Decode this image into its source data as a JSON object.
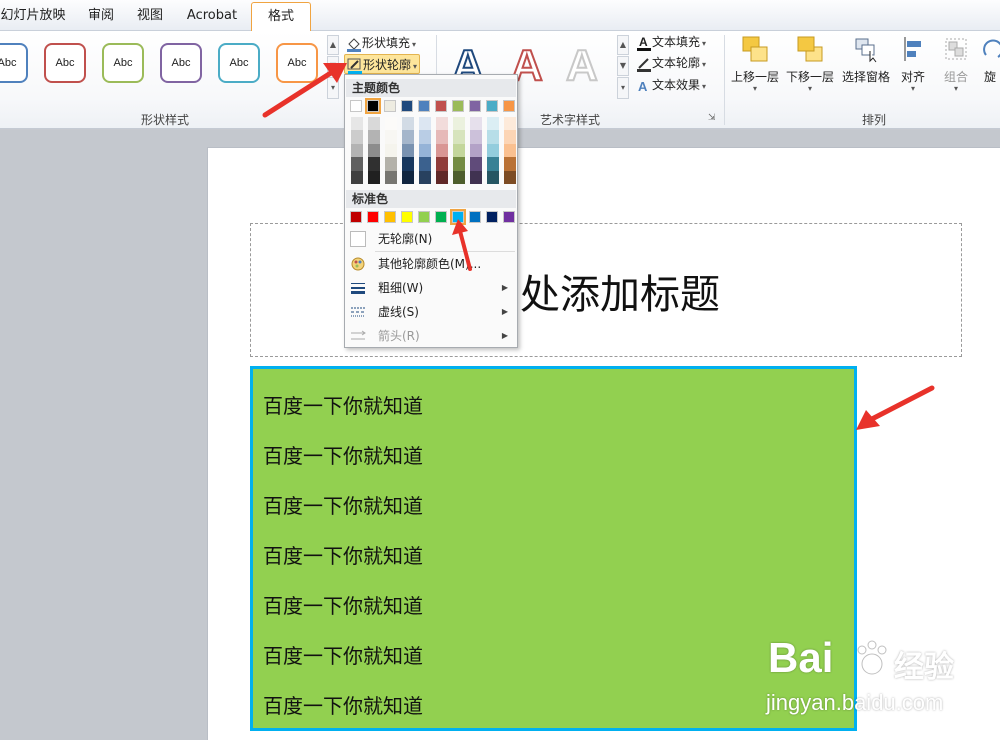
{
  "tabs": [
    {
      "label": "幻灯片放映",
      "active": false
    },
    {
      "label": "审阅",
      "active": false
    },
    {
      "label": "视图",
      "active": false
    },
    {
      "label": "Acrobat",
      "active": false
    },
    {
      "label": "格式",
      "active": true
    }
  ],
  "shape_styles": {
    "group_label": "形状样式",
    "swatches": [
      {
        "label": "Abc",
        "border": "#4f81bd"
      },
      {
        "label": "Abc",
        "border": "#c0504d"
      },
      {
        "label": "Abc",
        "border": "#9bbb59"
      },
      {
        "label": "Abc",
        "border": "#8064a2"
      },
      {
        "label": "Abc",
        "border": "#4bacc6"
      },
      {
        "label": "Abc",
        "border": "#f79646"
      }
    ],
    "shape_fill_label": "形状填充",
    "shape_outline_label": "形状轮廓"
  },
  "wordart": {
    "group_label": "艺术字样式",
    "text_fill_label": "文本填充",
    "text_outline_label": "文本轮廓",
    "text_effect_label": "文本效果"
  },
  "arrange": {
    "group_label": "排列",
    "bring_forward": "上移一层",
    "send_backward": "下移一层",
    "selection_pane": "选择窗格",
    "align": "对齐",
    "group": "组合",
    "rotate": "旋"
  },
  "outline_menu": {
    "theme_colors_label": "主题颜色",
    "theme_top_row": [
      "#ffffff",
      "#000000",
      "#eeece1",
      "#1f497d",
      "#4f81bd",
      "#c0504d",
      "#9bbb59",
      "#8064a2",
      "#4bacc6",
      "#f79646"
    ],
    "standard_colors_label": "标准色",
    "standard_colors": [
      "#c00000",
      "#ff0000",
      "#ffc000",
      "#ffff00",
      "#92d050",
      "#00b050",
      "#00b0f0",
      "#0070c0",
      "#002060",
      "#7030a0"
    ],
    "selected_standard_color": "#00b0f0",
    "no_outline": "无轮廓(N)",
    "more_colors": "其他轮廓颜色(M)...",
    "weight": "粗细(W)",
    "dashes": "虚线(S)",
    "arrows": "箭头(R)"
  },
  "slide": {
    "title_visible": "比处添加标题",
    "textbox_fill": "#92d050",
    "textbox_border": "#00b0f0",
    "lines": [
      "百度一下你就知道",
      "百度一下你就知道",
      "百度一下你就知道",
      "百度一下你就知道",
      "百度一下你就知道",
      "百度一下你就知道",
      "百度一下你就知道"
    ]
  },
  "watermark": {
    "brand": "Bai",
    "brand_cn": "经验",
    "url": "jingyan.baidu.com"
  }
}
